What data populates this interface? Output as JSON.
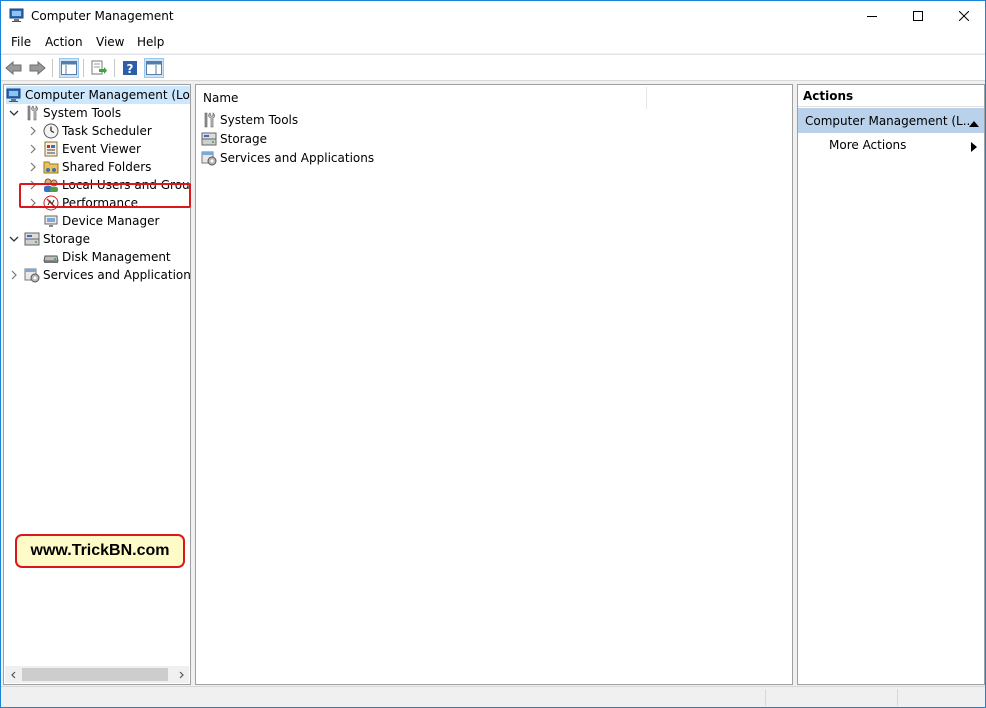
{
  "window": {
    "title": "Computer Management"
  },
  "menu": [
    "File",
    "Action",
    "View",
    "Help"
  ],
  "tree": {
    "root": "Computer Management (Local",
    "items": [
      {
        "label": "System Tools",
        "icon": "tools-icon",
        "level": 1,
        "expander": "expanded"
      },
      {
        "label": "Task Scheduler",
        "icon": "clock-icon",
        "level": 2,
        "expander": "collapsed"
      },
      {
        "label": "Event Viewer",
        "icon": "event-viewer-icon",
        "level": 2,
        "expander": "collapsed"
      },
      {
        "label": "Shared Folders",
        "icon": "shared-folders-icon",
        "level": 2,
        "expander": "collapsed"
      },
      {
        "label": "Local Users and Groups",
        "icon": "users-icon",
        "level": 2,
        "expander": "collapsed"
      },
      {
        "label": "Performance",
        "icon": "performance-icon",
        "level": 2,
        "expander": "collapsed"
      },
      {
        "label": "Device Manager",
        "icon": "device-manager-icon",
        "level": 2,
        "expander": "none"
      },
      {
        "label": "Storage",
        "icon": "storage-icon",
        "level": 1,
        "expander": "expanded"
      },
      {
        "label": "Disk Management",
        "icon": "disk-icon",
        "level": 2,
        "expander": "none"
      },
      {
        "label": "Services and Applications",
        "icon": "services-icon",
        "level": 1,
        "expander": "collapsed"
      }
    ]
  },
  "list": {
    "column_name": "Name",
    "rows": [
      "System Tools",
      "Storage",
      "Services and Applications"
    ]
  },
  "actions": {
    "header": "Actions",
    "section": "Computer Management (L...",
    "item": "More Actions"
  },
  "watermark": "www.TrickBN.com",
  "colors": {
    "selection": "#cce8ff",
    "actions_section": "#b9d1ea",
    "highlight": "#d9171c",
    "watermark_bg": "#fffbc8"
  }
}
